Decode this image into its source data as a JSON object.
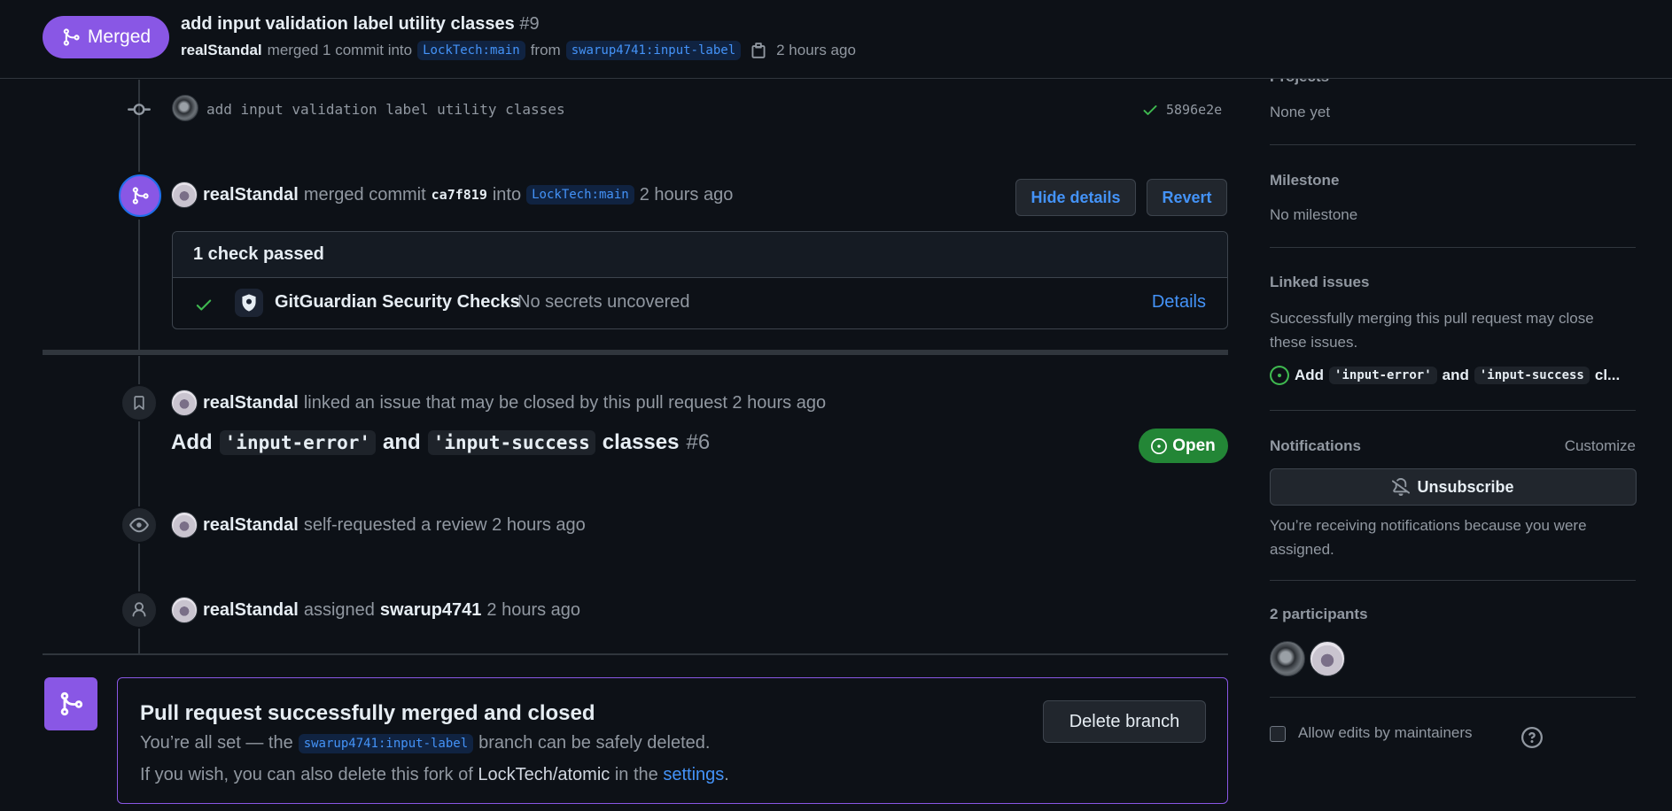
{
  "header": {
    "state_label": "Merged",
    "title": "add input validation label utility classes",
    "number": "#9",
    "author": "realStandal",
    "merged_text": "merged 1 commit into",
    "base_branch": "LockTech:main",
    "from_text": "from",
    "head_branch": "swarup4741:input-label",
    "time": "2 hours ago"
  },
  "commit": {
    "message": "add input validation label utility classes",
    "sha": "5896e2e"
  },
  "merge_event": {
    "author": "realStandal",
    "text1": "merged commit",
    "commit_sha": "ca7f819",
    "text2": "into",
    "branch": "LockTech:main",
    "time": "2 hours ago",
    "hide_details": "Hide details",
    "revert": "Revert",
    "checks_header": "1 check passed",
    "check_name": "GitGuardian Security Checks",
    "check_desc": "No secrets uncovered",
    "details": "Details"
  },
  "linked_event": {
    "author": "realStandal",
    "text": "linked an issue that may be closed by this pull request 2 hours ago",
    "issue_prefix": "Add",
    "issue_code1": "'input-error'",
    "issue_and": "and",
    "issue_code2": "'input-success",
    "issue_suffix": "classes",
    "issue_number": "#6",
    "status": "Open"
  },
  "review_event": {
    "author": "realStandal",
    "text": "self-requested a review 2 hours ago"
  },
  "assign_event": {
    "author": "realStandal",
    "text": "assigned",
    "assignee": "swarup4741",
    "time": "2 hours ago"
  },
  "merged_box": {
    "title": "Pull request successfully merged and closed",
    "line1_pre": "You’re all set — the",
    "line1_branch": "swarup4741:input-label",
    "line1_post": "branch can be safely deleted.",
    "line2_pre": "If you wish, you can also delete this fork of",
    "line2_repo": "LockTech/atomic",
    "line2_mid": "in the",
    "line2_link": "settings",
    "line2_end": ".",
    "delete_button": "Delete branch"
  },
  "sidebar": {
    "projects_heading": "Projects",
    "projects_value": "None yet",
    "milestone_heading": "Milestone",
    "milestone_value": "No milestone",
    "linked_heading": "Linked issues",
    "linked_desc": "Successfully merging this pull request may close these issues.",
    "linked_item_prefix": "Add",
    "linked_item_code1": "'input-error'",
    "linked_item_and": "and",
    "linked_item_code2": "'input-success",
    "linked_item_suffix": "cl...",
    "notifications_heading": "Notifications",
    "customize": "Customize",
    "unsubscribe": "Unsubscribe",
    "notifications_desc": "You’re receiving notifications because you were assigned.",
    "participants_heading": "2 participants",
    "allow_edits": "Allow edits by maintainers"
  },
  "colors": {
    "merged_purple": "#8957e5",
    "open_green": "#238636",
    "link_blue": "#4493f8"
  }
}
